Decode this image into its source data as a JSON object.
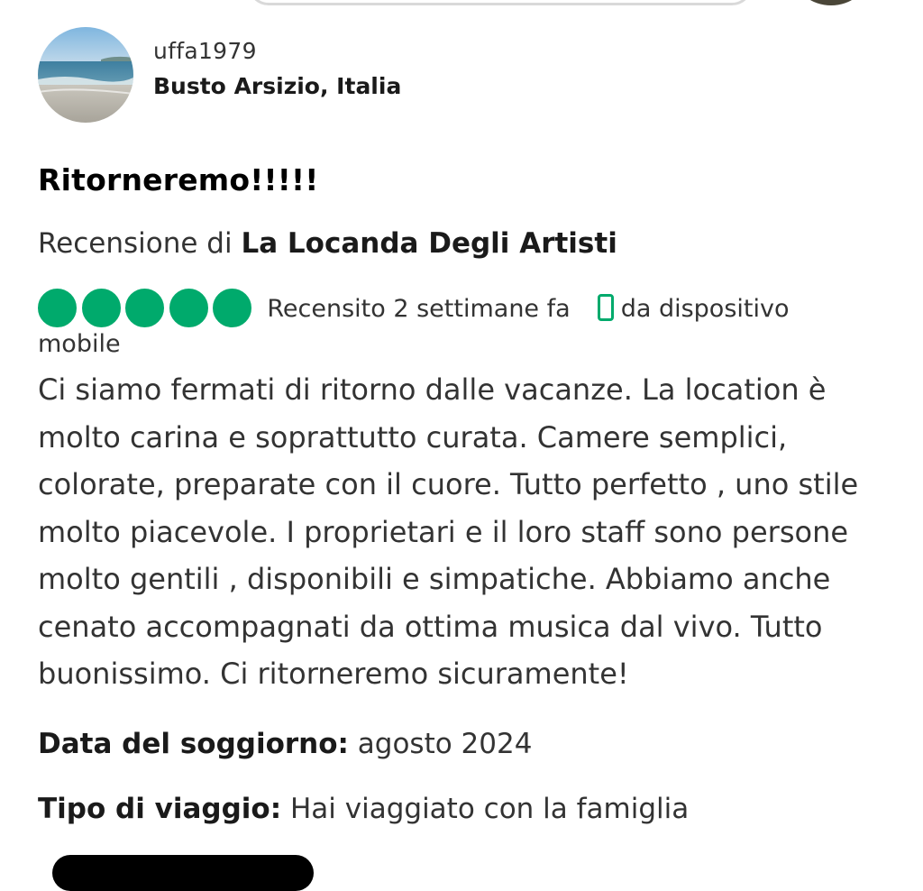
{
  "review": {
    "user": {
      "username": "uffa1979",
      "location": "Busto Arsizio, Italia"
    },
    "title": "Ritorneremo!!!!!",
    "reviewed_prefix": "Recensione di",
    "hotel_name": "La Locanda Degli Artisti",
    "rating": {
      "value": 5,
      "max": 5,
      "color": "#00aa6c"
    },
    "reviewed_when": "Recensito 2 settimane fa",
    "device_text": "da dispositivo",
    "device_text_wrap": "mobile",
    "device_icon": "mobile-phone-icon",
    "body": "Ci siamo fermati di ritorno dalle vacanze. La location è molto carina e soprattutto curata. Camere semplici, colorate, preparate con il cuore. Tutto perfetto , uno stile molto piacevole. I proprietari e il loro staff sono persone molto gentili , disponibili e simpatiche. Abbiamo anche cenato accompagnati da ottima musica dal vivo. Tutto buonissimo. Ci ritorneremo sicuramente!",
    "stay_date_label": "Data del soggiorno:",
    "stay_date_value": "agosto 2024",
    "trip_type_label": "Tipo di viaggio:",
    "trip_type_value": "Hai viaggiato con la famiglia"
  }
}
